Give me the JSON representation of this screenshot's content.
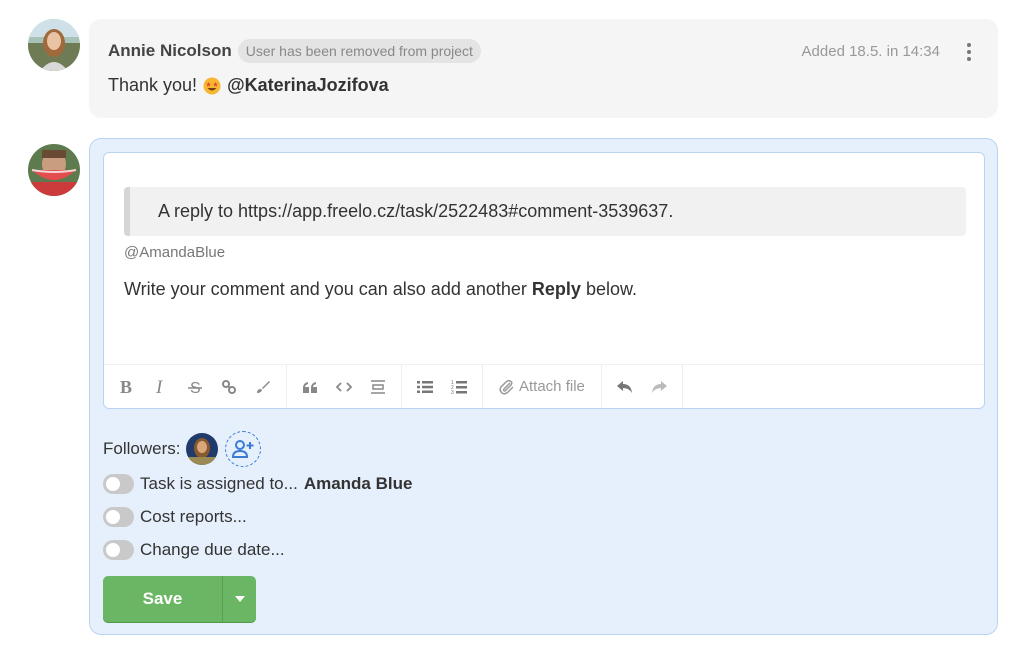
{
  "comment": {
    "author": "Annie Nicolson",
    "badge": "User has been removed from project",
    "meta": "Added 18.5. in 14:34",
    "body_text": "Thank you!",
    "emoji": "star-struck-emoji",
    "mention": "@KaterinaJozifova"
  },
  "reply": {
    "quote": "A reply to https://app.freelo.cz/task/2522483#comment-3539637.",
    "mention": "@AmandaBlue",
    "text_before": "Write your comment and you can also add another ",
    "text_bold": "Reply",
    "text_after": " below.",
    "toolbar": {
      "groups": [
        [
          "bold-icon",
          "italic-icon",
          "strikethrough-icon",
          "link-icon",
          "brush-icon"
        ],
        [
          "quote-icon",
          "code-icon",
          "horizontal-rule-icon"
        ],
        [
          "bullet-list-icon",
          "numbered-list-icon"
        ],
        [
          "attach-icon"
        ],
        [
          "undo-icon",
          "redo-icon"
        ]
      ],
      "attach_label": "Attach file"
    },
    "followers_label": "Followers:",
    "toggles": [
      {
        "label": "Task is assigned to...",
        "value": "Amanda Blue",
        "on": false
      },
      {
        "label": "Cost reports...",
        "value": "",
        "on": false
      },
      {
        "label": "Change due date...",
        "value": "",
        "on": false
      }
    ],
    "save_label": "Save"
  },
  "colors": {
    "accent_blue": "#3a7bd5",
    "save_green": "#6bb664",
    "panel_bg": "#e6f0fc"
  }
}
